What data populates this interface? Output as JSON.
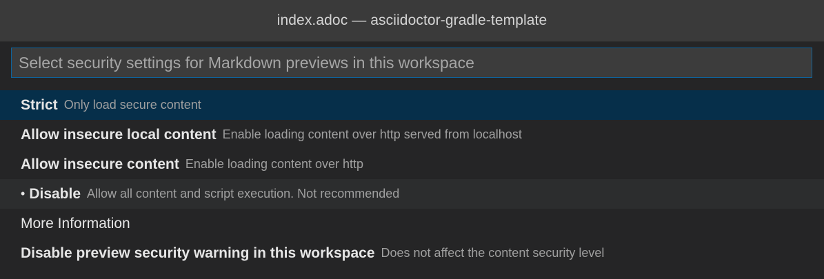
{
  "window": {
    "title": "index.adoc — asciidoctor-gradle-template"
  },
  "quick_pick": {
    "placeholder": "Select security settings for Markdown previews in this workspace",
    "items": [
      {
        "label": "Strict",
        "description": "Only load secure content",
        "selected": true
      },
      {
        "label": "Allow insecure local content",
        "description": "Enable loading content over http served from localhost"
      },
      {
        "label": "Allow insecure content",
        "description": "Enable loading content over http"
      },
      {
        "bullet": "•",
        "label": "Disable",
        "description": "Allow all content and script execution. Not recommended",
        "current": true
      },
      {
        "label": "More Information"
      },
      {
        "label": "Disable preview security warning in this workspace",
        "description": "Does not affect the content security level"
      }
    ]
  },
  "colors": {
    "titlebar_bg": "#3a3a3a",
    "panel_bg": "#252526",
    "input_bg": "#3c3c3c",
    "focus_border": "#0e639c",
    "selected_bg": "#062f4a",
    "current_bg": "#2c2d2e"
  }
}
